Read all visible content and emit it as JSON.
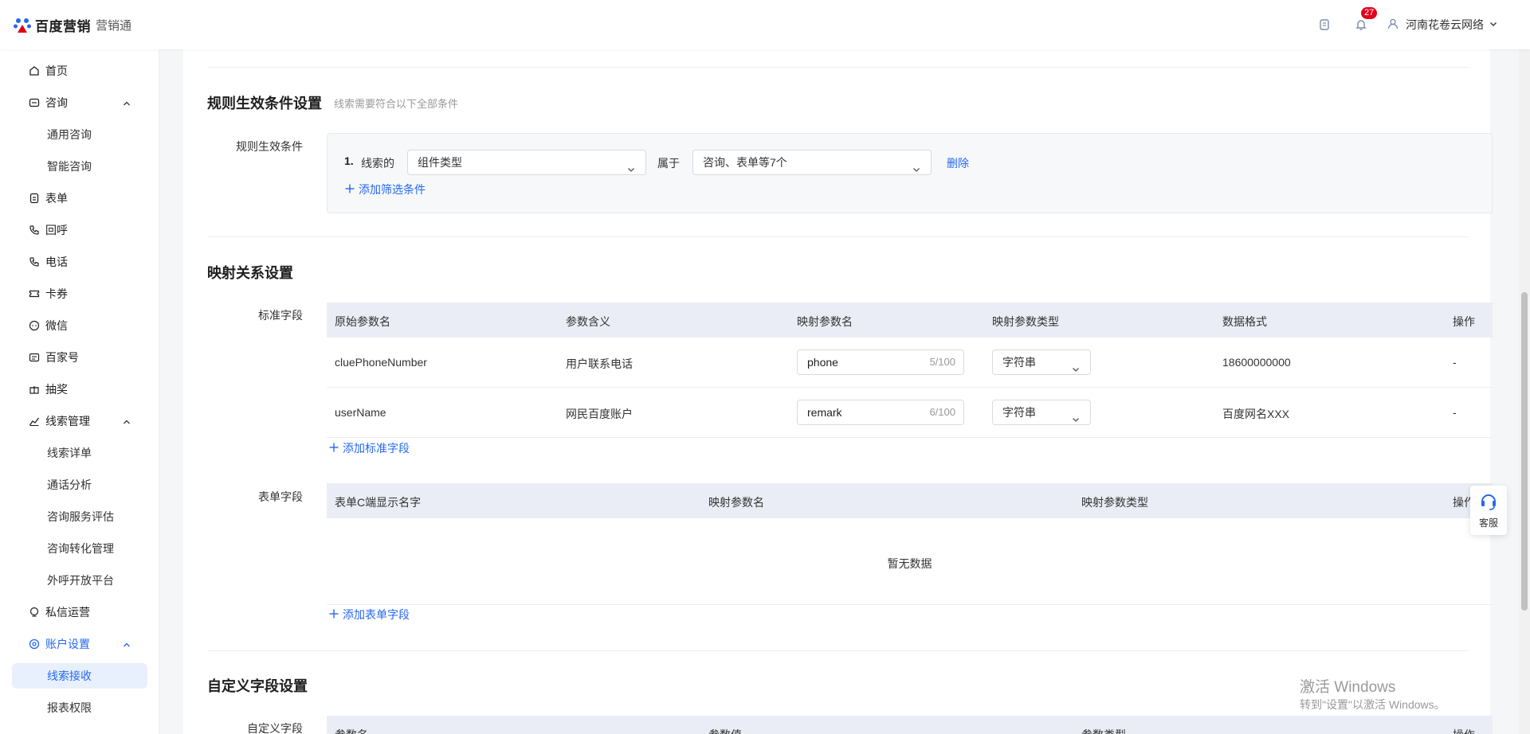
{
  "header": {
    "brand": "百度营销",
    "product": "营销通",
    "notification_count": "27",
    "account_name": "河南花卷云网络"
  },
  "sidebar": {
    "items": [
      {
        "label": "首页",
        "icon": "home-icon"
      },
      {
        "label": "咨询",
        "icon": "chat-icon"
      },
      {
        "label": "通用咨询"
      },
      {
        "label": "智能咨询"
      },
      {
        "label": "表单",
        "icon": "form-icon"
      },
      {
        "label": "回呼",
        "icon": "callback-icon"
      },
      {
        "label": "电话",
        "icon": "phone-icon"
      },
      {
        "label": "卡券",
        "icon": "coupon-icon"
      },
      {
        "label": "微信",
        "icon": "wechat-icon"
      },
      {
        "label": "百家号",
        "icon": "baijiahao-icon"
      },
      {
        "label": "抽奖",
        "icon": "gift-icon"
      },
      {
        "label": "线索管理",
        "icon": "chart-icon"
      },
      {
        "label": "线索详单"
      },
      {
        "label": "通话分析"
      },
      {
        "label": "咨询服务评估"
      },
      {
        "label": "咨询转化管理"
      },
      {
        "label": "外呼开放平台"
      },
      {
        "label": "私信运营",
        "icon": "private-message-icon"
      },
      {
        "label": "账户设置",
        "icon": "settings-icon"
      },
      {
        "label": "线索接收"
      },
      {
        "label": "报表权限"
      }
    ]
  },
  "rules": {
    "title": "规则生效条件设置",
    "hint": "线索需要符合以下全部条件",
    "field_label": "规则生效条件",
    "index": "1.",
    "prefix": "线索的",
    "field_select": "组件类型",
    "operator": "属于",
    "value_select": "咨询、表单等7个",
    "delete": "删除",
    "add_condition": "添加筛选条件"
  },
  "mapping": {
    "title": "映射关系设置",
    "standard_label": "标准字段",
    "standard_headers": [
      "原始参数名",
      "参数含义",
      "映射参数名",
      "映射参数类型",
      "数据格式",
      "操作"
    ],
    "standard_rows": [
      {
        "source": "cluePhoneNumber",
        "meaning": "用户联系电话",
        "target": "phone",
        "count": "5/100",
        "type": "字符串",
        "format": "18600000000",
        "op": "-"
      },
      {
        "source": "userName",
        "meaning": "网民百度账户",
        "target": "remark",
        "count": "6/100",
        "type": "字符串",
        "format": "百度网名XXX",
        "op": "-"
      }
    ],
    "add_standard": "添加标准字段",
    "form_label": "表单字段",
    "form_headers": [
      "表单C端显示名字",
      "映射参数名",
      "映射参数类型",
      "操作"
    ],
    "empty": "暂无数据",
    "add_form": "添加表单字段"
  },
  "custom": {
    "title": "自定义字段设置",
    "field_label": "自定义字段",
    "headers": [
      "参数名",
      "参数值",
      "参数类型",
      "操作"
    ]
  },
  "service": {
    "label": "客服"
  },
  "watermark": {
    "line1": "激活 Windows",
    "line2": "转到\"设置\"以激活 Windows。"
  }
}
